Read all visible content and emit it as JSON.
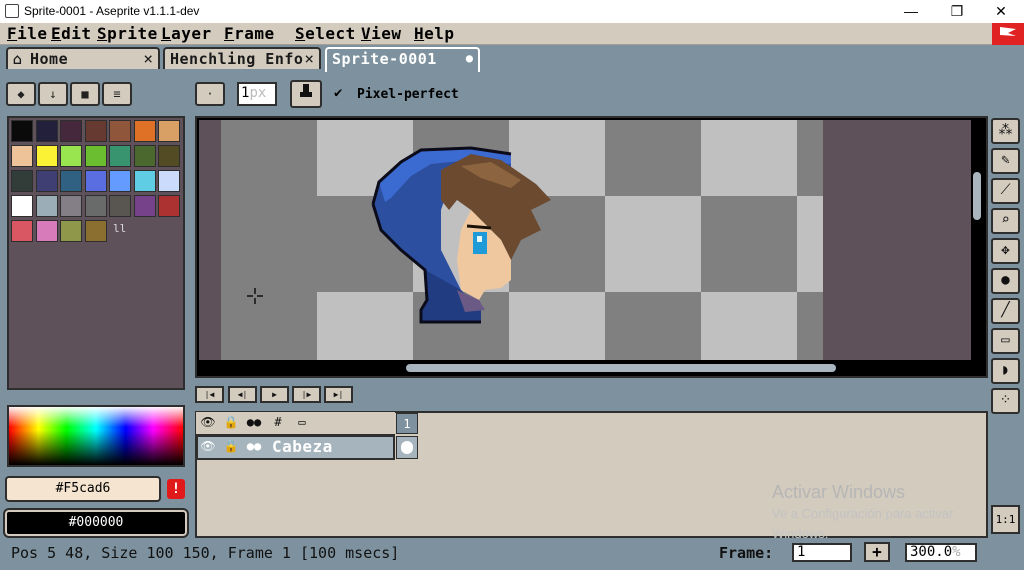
{
  "window": {
    "title": "Sprite-0001 - Aseprite v1.1.1-dev",
    "controls": {
      "minimize": "—",
      "maximize": "❐",
      "close": "✕"
    }
  },
  "menu": [
    "File",
    "Edit",
    "Sprite",
    "Layer",
    "Frame",
    "Select",
    "View",
    "Help"
  ],
  "tabs": [
    {
      "label": "Home",
      "close": "×"
    },
    {
      "label": "Henchling Enfo",
      "close": "×"
    },
    {
      "label": "Sprite-0001",
      "close": "●"
    }
  ],
  "toolbar": {
    "brush_size": "1",
    "brush_unit": "px",
    "pixel_perfect": "Pixel-perfect",
    "check": "✔"
  },
  "palette": {
    "swatches": [
      "#0a0a0a",
      "#22203a",
      "#45283c",
      "#663931",
      "#8f563b",
      "#df7126",
      "#d9a066",
      "#eec39a",
      "#fbf236",
      "#99e550",
      "#6abe30",
      "#37946e",
      "#4b692f",
      "#524b24",
      "#323c39",
      "#3f3f74",
      "#306082",
      "#5b6ee1",
      "#639bff",
      "#5fcde4",
      "#cbdbfc",
      "#ffffff",
      "#9badb7",
      "#847e87",
      "#696a6a",
      "#595652",
      "#76428a",
      "#ac3232",
      "#d95763",
      "#d77bba",
      "#8f974a",
      "#8a6f30"
    ],
    "ellipsis": "ll"
  },
  "colors": {
    "foreground": "#F5cad6",
    "background": "#000000",
    "warning": "!"
  },
  "tools": [
    "magic-wand",
    "pencil",
    "eyedropper",
    "zoom",
    "move",
    "paint-bucket",
    "line",
    "rectangle",
    "blob",
    "spray"
  ],
  "timeline": {
    "header_icons": [
      "👁",
      "🔒",
      "●●",
      "#",
      "▭"
    ],
    "layer": {
      "name": "Cabeza"
    },
    "frame_number": "1"
  },
  "watermark": {
    "line1": "Activar Windows",
    "line2": "Ve a Configuración para activar",
    "line3": "Windows."
  },
  "status": {
    "text": "Pos 5 48, Size 100 150, Frame 1 [100 msecs]",
    "frame_label": "Frame:",
    "frame_value": "1",
    "plus": "+",
    "zoom": "300.0",
    "zoom_unit": "%"
  },
  "one_to_one": "1:1"
}
